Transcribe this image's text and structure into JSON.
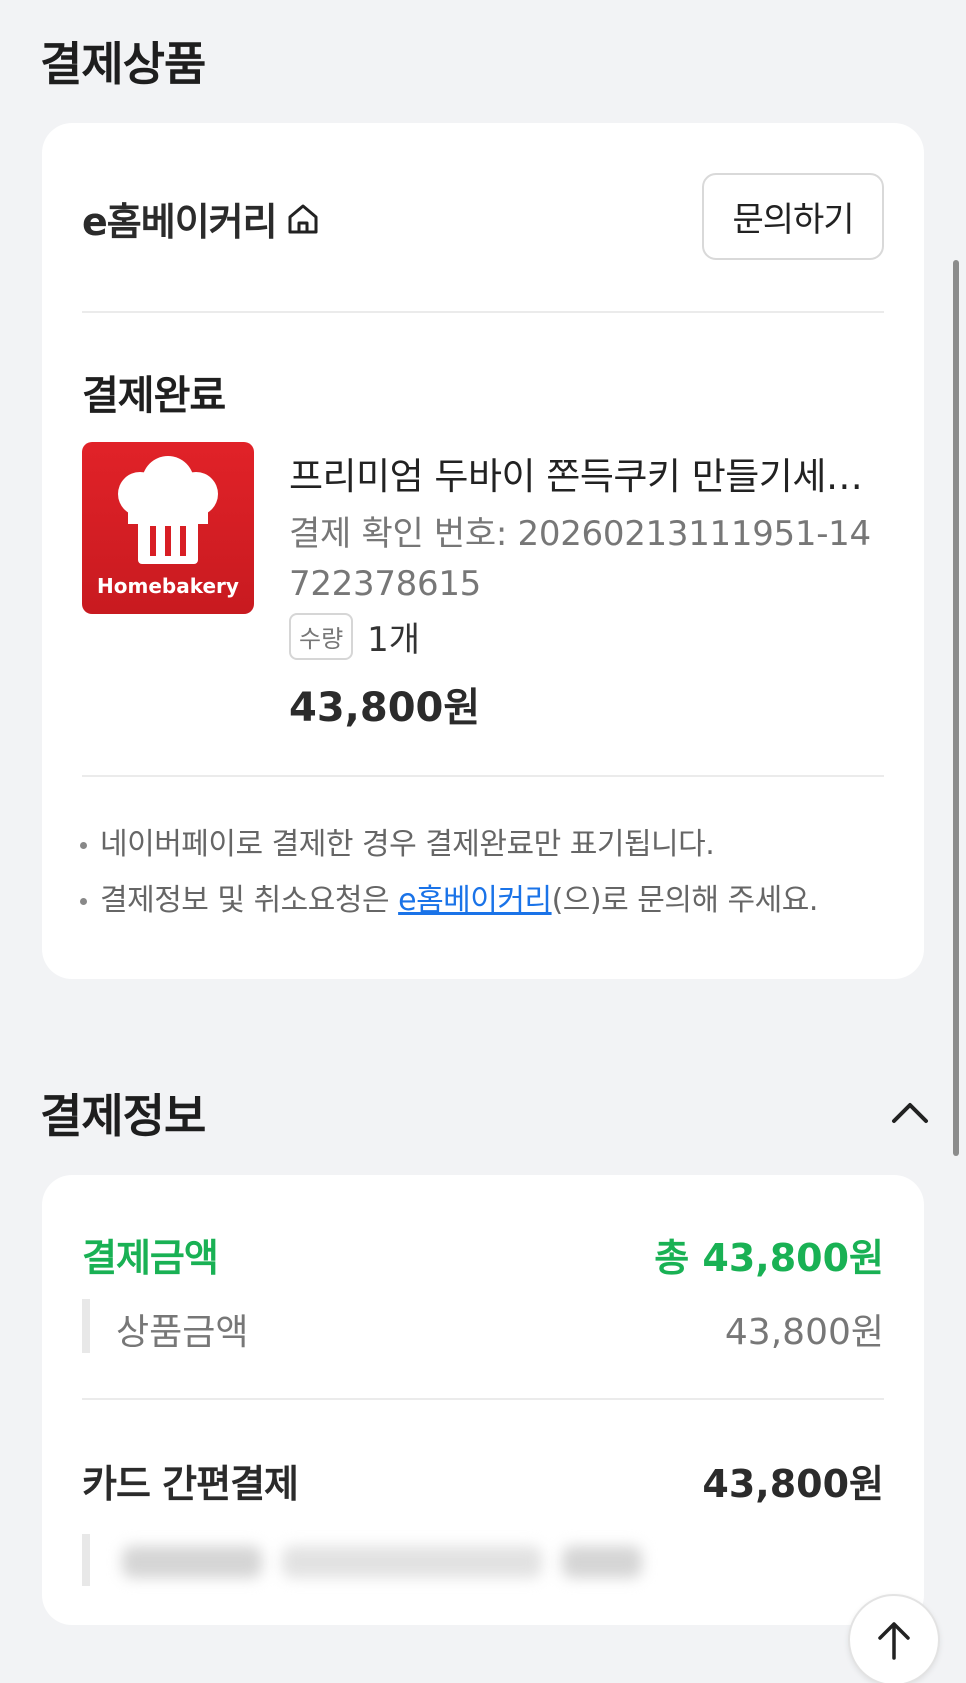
{
  "product_section": {
    "title": "결제상품",
    "seller_name": "e홈베이커리",
    "inquiry_button": "문의하기",
    "status": "결제완료",
    "thumbnail_brand": "Homebakery",
    "product_name": "프리미엄 두바이 쫀득쿠키 만들기세트…",
    "confirmation_number": "결제 확인 번호: 20260213111951-14722378615",
    "quantity_label": "수량",
    "quantity_value": "1개",
    "price": "43,800원",
    "notes": {
      "note1": "네이버페이로 결제한 경우 결제완료만 표기됩니다.",
      "note2_prefix": "결제정보 및 취소요청은 ",
      "note2_link": "e홈베이커리",
      "note2_suffix": "(으)로 문의해 주세요."
    }
  },
  "payment_section": {
    "title": "결제정보",
    "total_label": "결제금액",
    "total_value": "총 43,800원",
    "subtotal_label": "상품금액",
    "subtotal_value": "43,800원",
    "method_label": "카드 간편결제",
    "method_value": "43,800원"
  },
  "colors": {
    "accent_green": "#19b154",
    "link_blue": "#1a73e8",
    "brand_red": "#e12228"
  },
  "icons": {
    "home": "home-icon",
    "collapse": "chevron-up-icon",
    "scroll_top": "arrow-up-icon"
  }
}
